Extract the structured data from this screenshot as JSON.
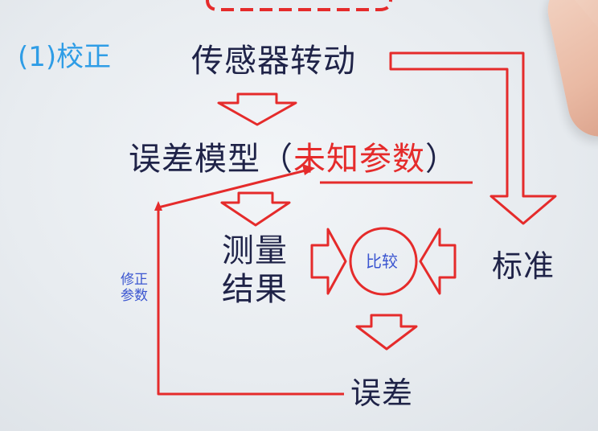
{
  "section_label": "(1)校正",
  "nodes": {
    "sensor_rotation": "传感器转动",
    "error_model": "误差模型（",
    "unknown_params": "未知参数",
    "error_model_close": "）",
    "measurement_line1": "测量",
    "measurement_line2": "结果",
    "compare": "比较",
    "standard": "标准",
    "error": "误差"
  },
  "feedback_label": {
    "line1": "修正",
    "line2": "参数"
  },
  "colors": {
    "arrow_red": "#e52b2b",
    "text_navy": "#1f2348",
    "label_blue": "#2f9de6",
    "feedback_blue": "#3a55d0"
  }
}
